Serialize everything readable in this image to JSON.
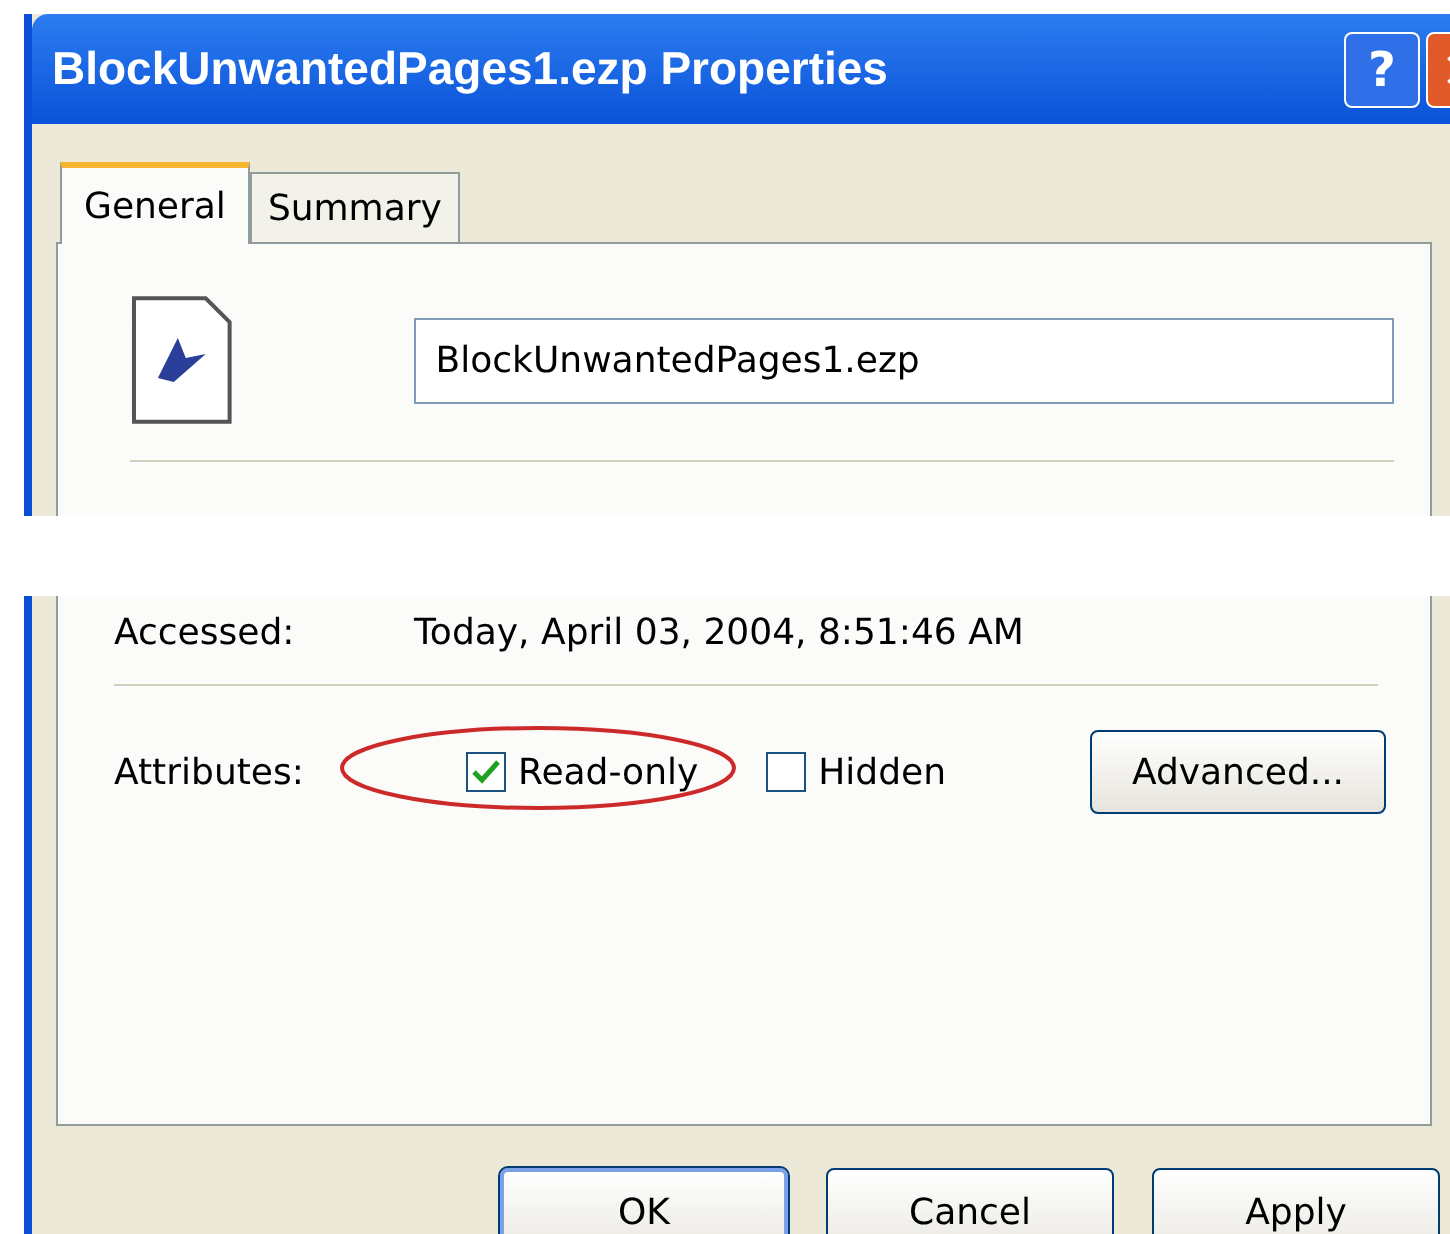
{
  "window": {
    "title": "BlockUnwantedPages1.ezp Properties",
    "help_button": "?"
  },
  "tabs": [
    {
      "label": "General",
      "selected": true
    },
    {
      "label": "Summary",
      "selected": false
    }
  ],
  "file_name": "BlockUnwantedPages1.ezp",
  "details": [
    {
      "label": "Accessed:",
      "value": "Today, April 03, 2004, 8:51:46 AM"
    }
  ],
  "attributes": {
    "label": "Attributes:",
    "checkboxes": [
      {
        "label": "Read-only",
        "checked": true,
        "circled": true
      },
      {
        "label": "Hidden",
        "checked": false,
        "circled": false
      }
    ],
    "button": "Advanced..."
  },
  "buttons": [
    {
      "label": "OK",
      "default": true
    },
    {
      "label": "Cancel",
      "default": false
    },
    {
      "label": "Apply",
      "default": false
    }
  ]
}
